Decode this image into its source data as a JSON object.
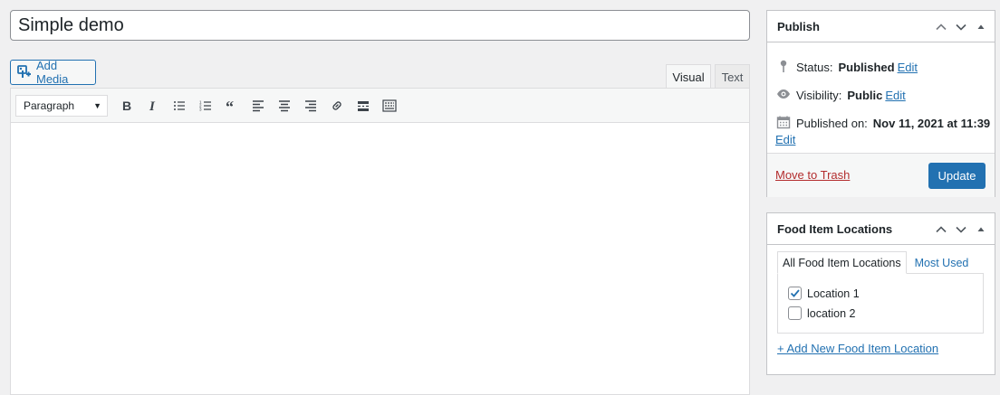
{
  "post": {
    "title": "Simple demo"
  },
  "media": {
    "add_label": "Add Media",
    "icon": "add-media-icon"
  },
  "editor": {
    "tabs": [
      {
        "label": "Visual"
      },
      {
        "label": "Text"
      }
    ],
    "format_select": "Paragraph",
    "toolbar_icons": [
      "bold-icon",
      "italic-icon",
      "bulleted-list-icon",
      "numbered-list-icon",
      "blockquote-icon",
      "align-left-icon",
      "align-center-icon",
      "align-right-icon",
      "link-icon",
      "read-more-icon",
      "toolbar-toggle-icon"
    ]
  },
  "publish": {
    "title": "Publish",
    "status_label": "Status:",
    "status_value": "Published",
    "visibility_label": "Visibility:",
    "visibility_value": "Public",
    "published_label": "Published on:",
    "published_value": "Nov 11, 2021 at 11:39",
    "edit_label": "Edit",
    "trash_label": "Move to Trash",
    "update_label": "Update"
  },
  "food_locations": {
    "title": "Food Item Locations",
    "tabs": [
      {
        "label": "All Food Item Locations"
      },
      {
        "label": "Most Used"
      }
    ],
    "items": [
      {
        "label": "Location 1",
        "checked": true
      },
      {
        "label": "location 2",
        "checked": false
      }
    ],
    "add_new": "+ Add New Food Item Location"
  },
  "colors": {
    "accent": "#2271b1",
    "danger": "#b32d2e",
    "border": "#c3c4c7"
  }
}
